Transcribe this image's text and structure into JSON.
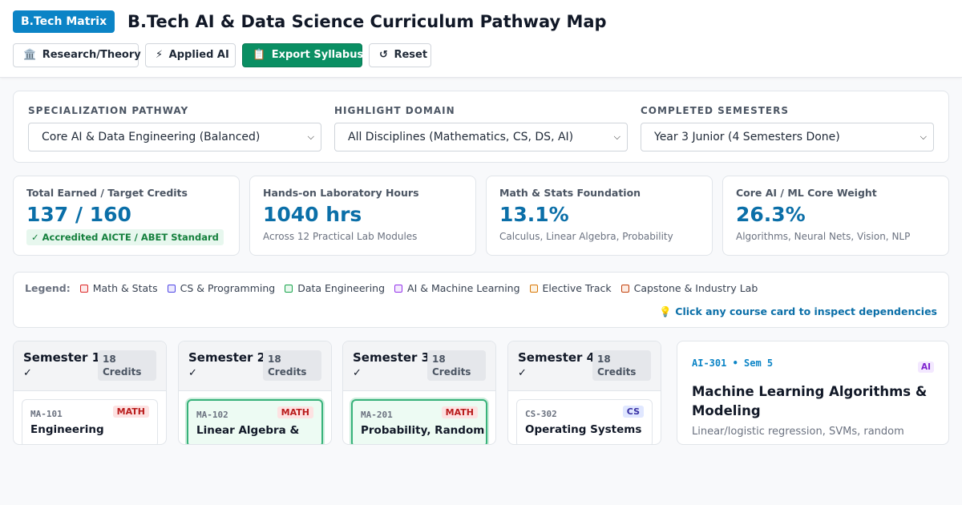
{
  "header": {
    "badge": "B.Tech Matrix",
    "title": "B.Tech AI & Data Science Curriculum Pathway Map",
    "buttons": [
      {
        "icon": "🏛️",
        "label": "Research/Theory"
      },
      {
        "icon": "⚡",
        "label": "Applied AI"
      },
      {
        "icon": "📋",
        "label": "Export Syllabus"
      },
      {
        "icon": "↺",
        "label": "Reset"
      }
    ]
  },
  "filters": [
    {
      "label": "SPECIALIZATION PATHWAY",
      "value": "Core AI & Data Engineering (Balanced)"
    },
    {
      "label": "HIGHLIGHT DOMAIN",
      "value": "All Disciplines (Mathematics, CS, DS, AI)"
    },
    {
      "label": "COMPLETED SEMESTERS",
      "value": "Year 3 Junior (4 Semesters Done)"
    }
  ],
  "stats": [
    {
      "label": "Total Earned / Target Credits",
      "value": "137 / 160",
      "badge": "✓ Accredited AICTE / ABET Standard"
    },
    {
      "label": "Hands-on Laboratory Hours",
      "value": "1040 hrs",
      "sub": "Across 12 Practical Lab Modules"
    },
    {
      "label": "Math & Stats Foundation",
      "value": "13.1%",
      "sub": "Calculus, Linear Algebra, Probability"
    },
    {
      "label": "Core AI / ML Core Weight",
      "value": "26.3%",
      "sub": "Algorithms, Neural Nets, Vision, NLP"
    }
  ],
  "legend": {
    "title": "Legend:",
    "items": [
      {
        "label": "Math & Stats",
        "color": "#dc2626",
        "fill": "#fdeaea"
      },
      {
        "label": "CS & Programming",
        "color": "#4f46e5",
        "fill": "#eceafd"
      },
      {
        "label": "Data Engineering",
        "color": "#16a34a",
        "fill": "#e9f8ee"
      },
      {
        "label": "AI & Machine Learning",
        "color": "#9333ea",
        "fill": "#f4eafd"
      },
      {
        "label": "Elective Track",
        "color": "#d97706",
        "fill": "#fdf3e3"
      },
      {
        "label": "Capstone & Industry Lab",
        "color": "#c2410c",
        "fill": "#fdece3"
      }
    ],
    "hint": "💡 Click any course card to inspect dependencies"
  },
  "semesters": [
    {
      "title": "Semester 1",
      "check": "✓",
      "credits": "18 Credits",
      "course": {
        "code": "MA-101",
        "tag": "MATH",
        "name": "Engineering"
      }
    },
    {
      "title": "Semester 2",
      "check": "✓",
      "credits": "18 Credits",
      "course": {
        "code": "MA-102",
        "tag": "MATH",
        "name": "Linear Algebra &"
      }
    },
    {
      "title": "Semester 3",
      "check": "✓",
      "credits": "18 Credits",
      "course": {
        "code": "MA-201",
        "tag": "MATH",
        "name": "Probability, Random"
      }
    },
    {
      "title": "Semester 4",
      "check": "✓",
      "credits": "18 Credits",
      "course": {
        "code": "CS-302",
        "tag": "CS",
        "name": "Operating Systems"
      }
    }
  ],
  "detail": {
    "code": "AI-301 • Sem 5",
    "tag": "AI",
    "title": "Machine Learning Algorithms & Modeling",
    "desc": "Linear/logistic regression, SVMs, random"
  }
}
